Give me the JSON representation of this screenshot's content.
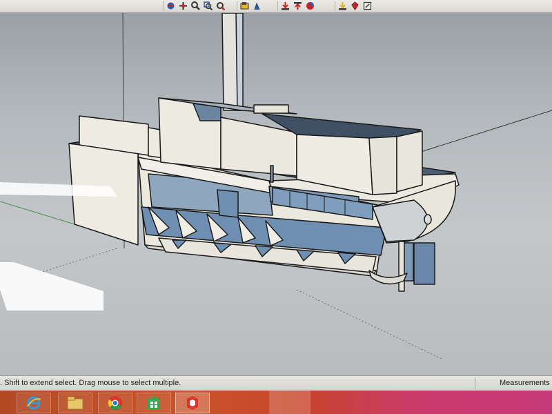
{
  "toolbar": {
    "groups": [
      {
        "name": "view-tools",
        "icons": [
          "orbit-icon",
          "pan-icon",
          "zoom-icon",
          "zoom-window-icon",
          "zoom-extents-icon"
        ]
      },
      {
        "name": "section-tools",
        "icons": [
          "section-plane-icon",
          "walk-icon"
        ]
      },
      {
        "name": "warehouse-tools",
        "icons": [
          "get-models-icon",
          "share-model-icon",
          "components-icon"
        ]
      },
      {
        "name": "extension-tools",
        "icons": [
          "get-extensions-icon",
          "ruby-icon",
          "layout-icon"
        ]
      }
    ],
    "colors": {
      "blue": "#2c5ea8",
      "red": "#c0262a",
      "yellow": "#e0b52a",
      "gray": "#4a4a4a"
    }
  },
  "status": {
    "hint": ". Shift to extend select. Drag mouse to select multiple.",
    "measurements_label": "Measurements"
  },
  "taskbar": {
    "apps": [
      {
        "name": "internet-explorer-icon",
        "active": false
      },
      {
        "name": "file-explorer-icon",
        "active": false
      },
      {
        "name": "chrome-icon",
        "active": false
      },
      {
        "name": "store-icon",
        "active": false
      },
      {
        "name": "sketchup-icon",
        "active": true
      }
    ]
  },
  "viewport": {
    "model": "paddle-boat-3d-model",
    "colors": {
      "face": "#eceadf",
      "shade": "#7f9ab6",
      "edge": "#1a1a1a"
    }
  }
}
